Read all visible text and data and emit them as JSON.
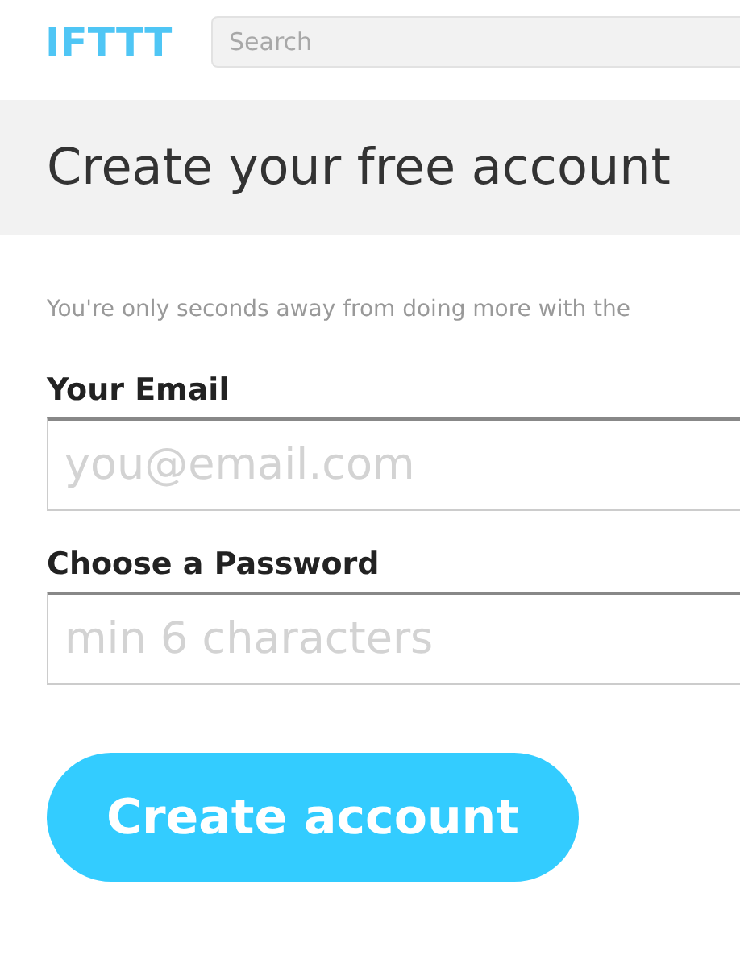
{
  "header": {
    "logo": "IFTTT",
    "search": {
      "placeholder": "Search"
    }
  },
  "title": "Create your free account",
  "subtitle": "You're only seconds away from doing more with the",
  "fields": [
    {
      "label": "Your Email",
      "placeholder": "you@email.com"
    },
    {
      "label": "Choose a Password",
      "placeholder": "min 6 characters"
    }
  ],
  "submit": "Create account"
}
